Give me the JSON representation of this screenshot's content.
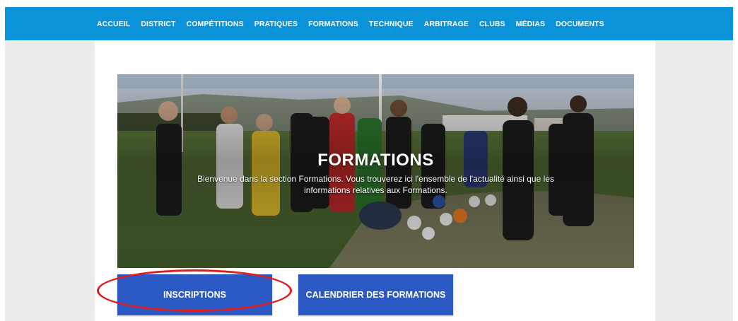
{
  "nav": {
    "items": [
      "ACCUEIL",
      "DISTRICT",
      "COMPÉTITIONS",
      "PRATIQUES",
      "FORMATIONS",
      "TECHNIQUE",
      "ARBITRAGE",
      "CLUBS",
      "MÉDIAS",
      "DOCUMENTS"
    ]
  },
  "hero": {
    "title": "FORMATIONS",
    "subtitle": "Bienvenue dans la section Formations. Vous trouverez ici l'ensemble de l'actualité ainsi que les informations relatives aux Formations."
  },
  "buttons": {
    "inscriptions": "INSCRIPTIONS",
    "calendar": "CALENDRIER DES FORMATIONS"
  },
  "colors": {
    "nav_bg": "#0a93d8",
    "button_bg": "#2a59c4",
    "highlight": "#e21b1b",
    "page_bg": "#ececec"
  }
}
